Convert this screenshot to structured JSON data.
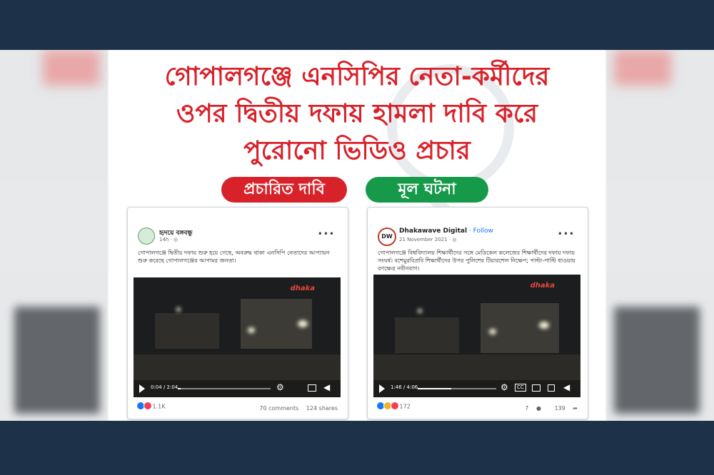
{
  "headline": {
    "line1": "গোপালগঞ্জে এনসিপির নেতা-কর্মীদের",
    "line2": "ওপর দ্বিতীয় দফায় হামলা দাবি করে",
    "line3": "পুরোনো ভিডিও প্রচার"
  },
  "labels": {
    "claim": "প্রচারিত দাবি",
    "fact": "মূল ঘটনা"
  },
  "colors": {
    "accent_red": "#d8222a",
    "accent_green": "#169a4a",
    "frame": "#1d3248"
  },
  "left_post": {
    "page_name": "হৃদয়ে বঙ্গবন্ধু",
    "time": "14h · ",
    "text": "গোপালগঞ্জে দ্বিতীয় দফায় শুরু হয়ে গেছে, অবরুদ্ধ থাকা এনসিপি নেতাদের আপ্যায়ন শুরু করেছে গোপালগঞ্জের আপামর জনতা।",
    "video_logo": "dhaka",
    "video_time": "0:04 / 2:04",
    "progress": 0.03,
    "reaction_count": "1.1K",
    "comments": "70 comments",
    "shares": "124 shares"
  },
  "right_post": {
    "avatar_text": "DW",
    "page_name": "Dhakawave Digital",
    "follow": " · Follow",
    "time": "21 November 2021 · ",
    "text": "গোপালগঞ্জে বিশ্ববিদ্যালয় শিক্ষার্থীদের সঙ্গে মেডিকেল কলেজের শিক্ষার্থীদের দফায় দফায় সংঘর্ষ। বশেমুরবিপ্রবি শিক্ষার্থীদের উপর পুলিশের টিয়ারশেল নিক্ষেপ; পাল্টা-পাল্টি ধাওয়ায় রণক্ষেত্র নবীনবাগ।",
    "video_logo": "dhaka",
    "video_time": "1:46 / 4:06",
    "cc": "CC",
    "progress": 0.43,
    "reaction_count": "172",
    "comments": "7",
    "shares": "139"
  },
  "icons": {
    "more": "more-icon",
    "play": "play-icon",
    "settings": "gear-icon",
    "volume": "volume-icon",
    "pip": "pip-icon"
  }
}
